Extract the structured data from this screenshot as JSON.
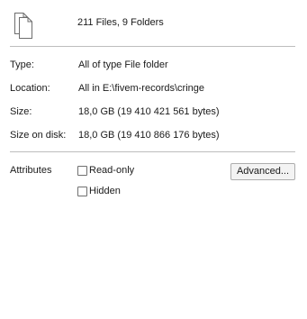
{
  "header": {
    "icon": "multiple-files-icon",
    "summary": "211 Files, 9 Folders"
  },
  "properties": [
    {
      "label": "Type:",
      "value": "All of type File folder"
    },
    {
      "label": "Location:",
      "value": "All in E:\\fivem-records\\cringe"
    },
    {
      "label": "Size:",
      "value": "18,0 GB (19 410 421 561 bytes)"
    },
    {
      "label": "Size on disk:",
      "value": "18,0 GB (19 410 866 176 bytes)"
    }
  ],
  "attributes": {
    "label": "Attributes",
    "readonly_label": "Read-only",
    "hidden_label": "Hidden",
    "advanced_label": "Advanced..."
  }
}
